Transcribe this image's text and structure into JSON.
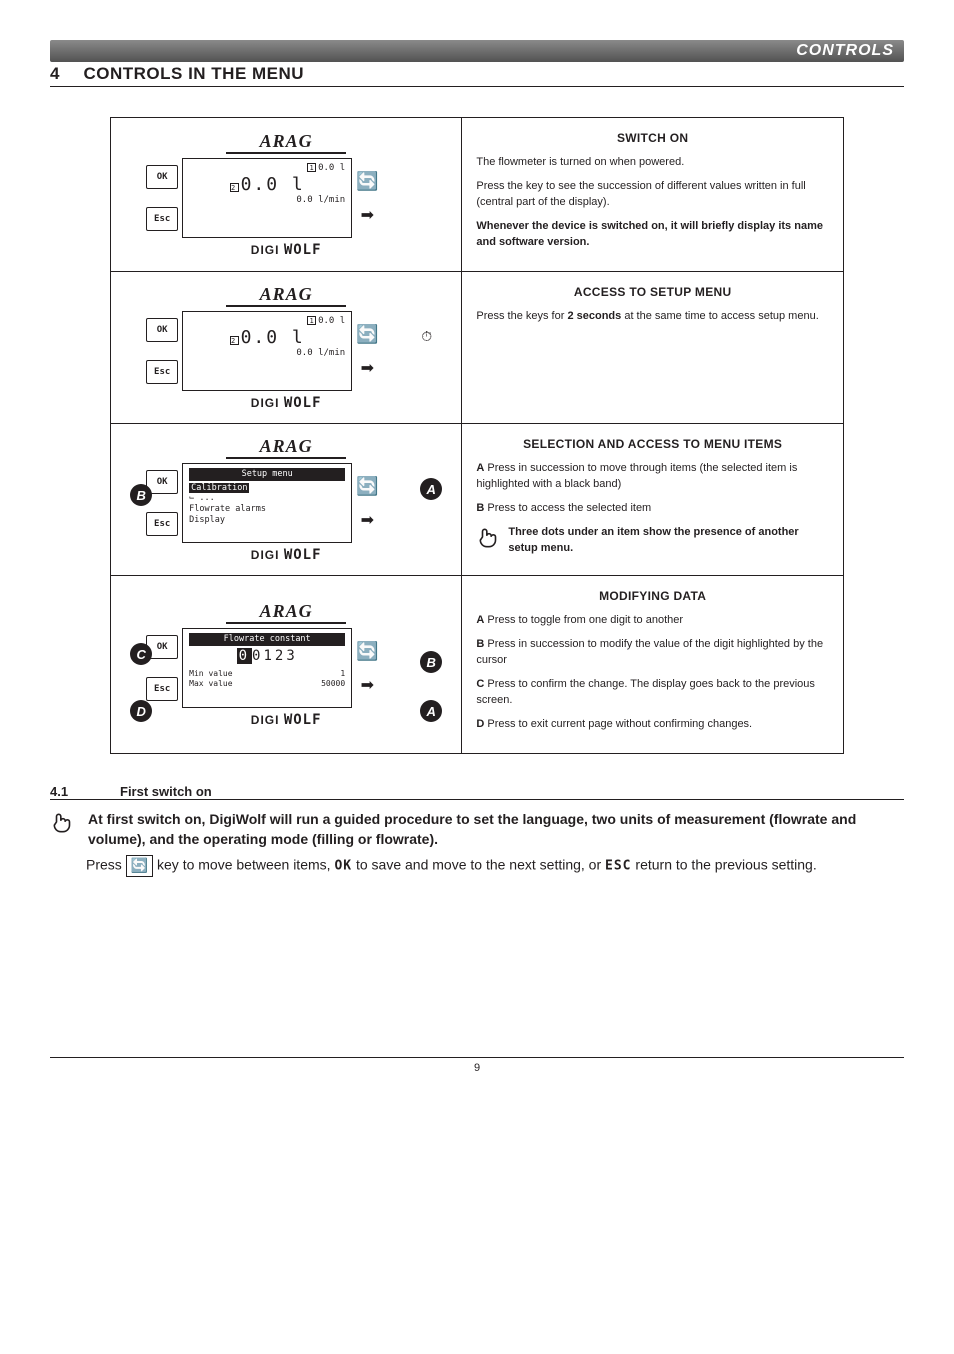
{
  "header_bar": "CONTROLS",
  "section": {
    "num": "4",
    "title": "CONTROLS IN THE MENU"
  },
  "device": {
    "brand": "ARAG",
    "ok": "OK",
    "esc": "Esc",
    "digi": "DIGI",
    "wolf": "WOLF"
  },
  "screens": {
    "power": {
      "sup1": "1",
      "sup2": "2",
      "top": "0.0 l",
      "big": "0.0 l",
      "bot": "0.0 l/min"
    },
    "menu": {
      "title": "Setup menu",
      "item_hl": "Calibration",
      "item_dots": "⌙ ...",
      "item2": "Flowrate alarms",
      "item3": "Display"
    },
    "edit": {
      "title": "Flowrate constant",
      "cursor": "0",
      "rest": "0123",
      "min_label": "Min value",
      "min_val": "1",
      "max_label": "Max value",
      "max_val": "50000"
    }
  },
  "rows": {
    "r1": {
      "title": "SWITCH ON",
      "p1": "The flowmeter is turned on when powered.",
      "p2": "Press the key to see the succession of different values written in full (central part of the display).",
      "p3": "Whenever the device is switched on, it will briefly display its name and software version."
    },
    "r2": {
      "title": "ACCESS TO SETUP MENU",
      "p1_a": "Press the keys for ",
      "p1_b": "2 seconds",
      "p1_c": " at the same time to access setup menu."
    },
    "r3": {
      "title": "SELECTION AND ACCESS TO MENU ITEMS",
      "a_label": "A",
      "a_text": " Press in succession to move through items (the selected item is highlighted with a black band)",
      "b_label": "B",
      "b_text": " Press to access the selected item",
      "note": "Three dots under an item show the presence of another setup menu."
    },
    "r4": {
      "title": "MODIFYING DATA",
      "a_label": "A",
      "a_text": " Press to toggle from one digit to another",
      "b_label": "B",
      "b_text": " Press in succession to modify the value of the digit highlighted by the cursor",
      "c_label": "C",
      "c_text": " Press to confirm the change. The display goes back to the previous screen.",
      "d_label": "D",
      "d_text": " Press to exit current page without confirming changes."
    }
  },
  "subsection": {
    "num": "4.1",
    "title": "First switch on"
  },
  "first_note": "At first switch on, DigiWolf will run a guided procedure to set the language, two units of measurement (flowrate and volume), and the operating mode (filling or flowrate).",
  "press_line": {
    "a": "Press ",
    "b": " key to move between items, ",
    "ok": "OK",
    "c": " to save and move to the next setting, or ",
    "esc": "ESC",
    "d": " return to the previous setting."
  },
  "page_num": "9"
}
